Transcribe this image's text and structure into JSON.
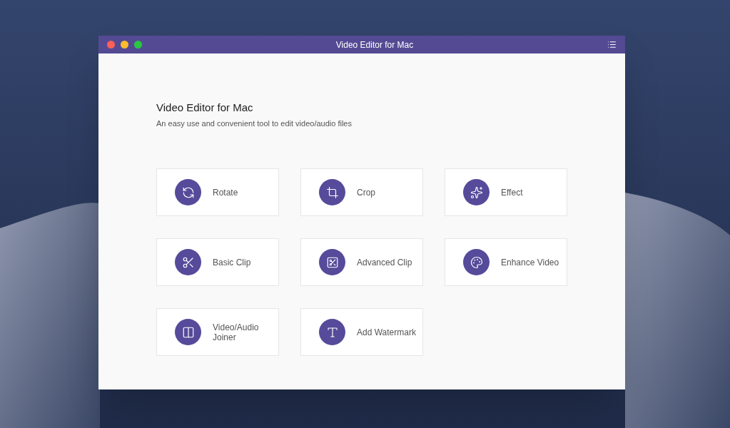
{
  "window": {
    "title": "Video Editor for Mac"
  },
  "heading": "Video Editor for Mac",
  "subtitle": "An easy use and convenient tool to edit video/audio files",
  "tools": [
    {
      "kind": "rotate",
      "label": "Rotate"
    },
    {
      "kind": "crop",
      "label": "Crop"
    },
    {
      "kind": "effect",
      "label": "Effect"
    },
    {
      "kind": "clip",
      "label": "Basic Clip"
    },
    {
      "kind": "advanced",
      "label": "Advanced Clip"
    },
    {
      "kind": "enhance",
      "label": "Enhance Video"
    },
    {
      "kind": "joiner",
      "label": "Video/Audio Joiner"
    },
    {
      "kind": "text",
      "label": "Add Watermark"
    }
  ]
}
